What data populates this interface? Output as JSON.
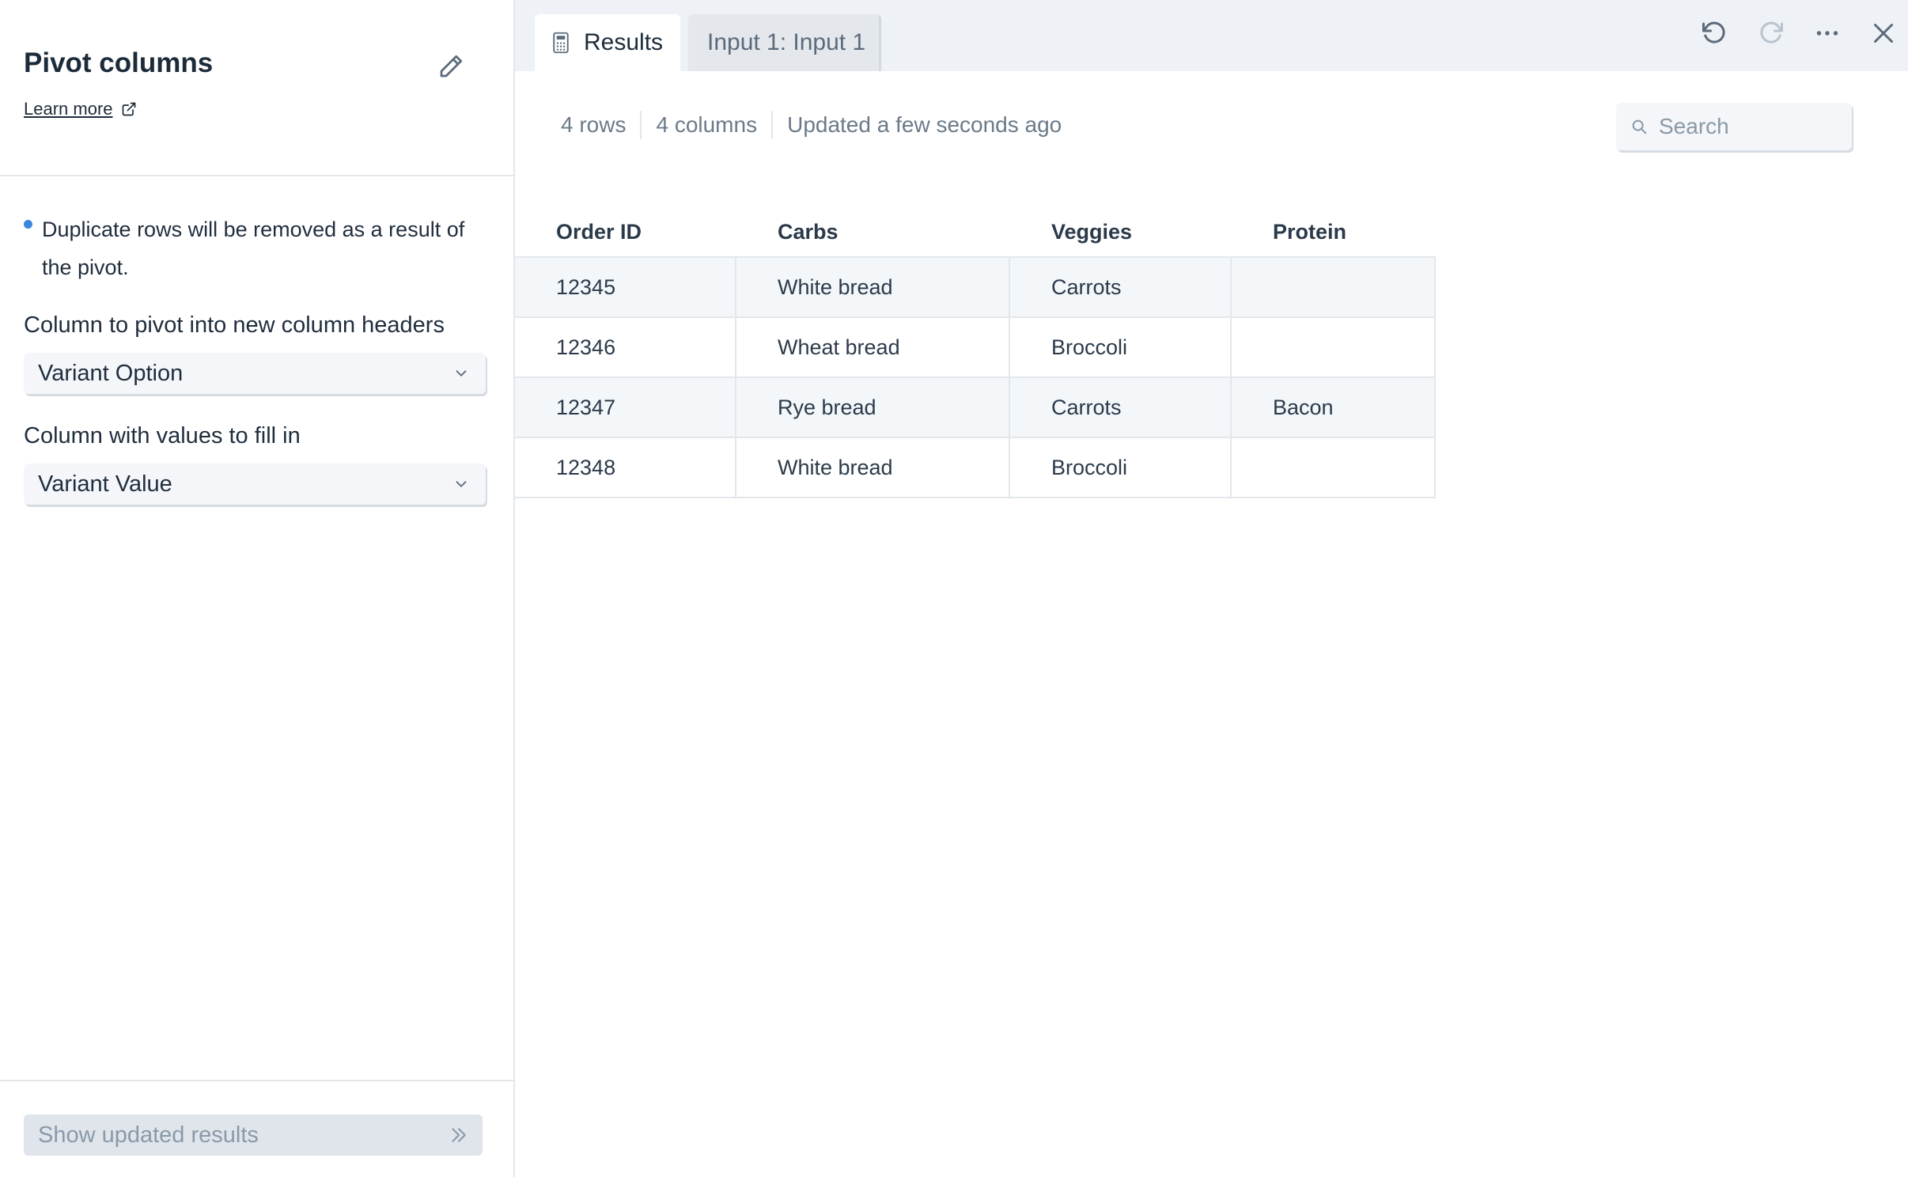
{
  "left_panel": {
    "title": "Pivot columns",
    "learn_more": "Learn more",
    "notice": "Duplicate rows will be removed as a result of the pivot.",
    "pivot_label": "Column to pivot into new column headers",
    "pivot_value": "Variant Option",
    "values_label": "Column with values to fill in",
    "values_value": "Variant Value",
    "show_results": "Show updated results"
  },
  "tabs": [
    {
      "label": "Results",
      "icon": "calculator-icon",
      "active": true
    },
    {
      "label": "Input 1: Input 1",
      "active": false
    }
  ],
  "toolbar": {
    "icons": [
      "undo-icon",
      "redo-icon",
      "more-icon",
      "close-icon"
    ]
  },
  "meta": {
    "rows": "4 rows",
    "columns": "4 columns",
    "updated": "Updated a few seconds ago"
  },
  "search": {
    "placeholder": "Search"
  },
  "table": {
    "headers": [
      "Order ID",
      "Carbs",
      "Veggies",
      "Protein"
    ],
    "rows": [
      [
        "12345",
        "White bread",
        "Carrots",
        ""
      ],
      [
        "12346",
        "Wheat bread",
        "Broccoli",
        ""
      ],
      [
        "12347",
        "Rye bread",
        "Carrots",
        "Bacon"
      ],
      [
        "12348",
        "White bread",
        "Broccoli",
        ""
      ]
    ]
  },
  "colors": {
    "accent": "#3b87e0",
    "topbar_bg": "#eef1f5",
    "text": "#1f2d3d",
    "muted": "#6b7a89"
  }
}
